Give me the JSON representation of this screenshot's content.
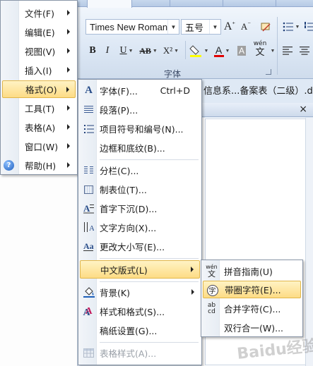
{
  "ribbon": {
    "font_name": "Times New Roman",
    "font_size": "五号",
    "group_label": "字体",
    "bold": "B",
    "italic": "I",
    "underline": "U",
    "strike": "AB",
    "superscript": "X²",
    "font_color": "A",
    "char_shading": "A",
    "phonetic": "wén",
    "grow_font": "A",
    "shrink_font": "A"
  },
  "document": {
    "title_fragment": "信息系...备案表（二级）.doc"
  },
  "task_pane": {
    "close": "×"
  },
  "main_menu": {
    "items": [
      {
        "label": "文件(F)"
      },
      {
        "label": "编辑(E)"
      },
      {
        "label": "视图(V)"
      },
      {
        "label": "插入(I)"
      },
      {
        "label": "格式(O)"
      },
      {
        "label": "工具(T)"
      },
      {
        "label": "表格(A)"
      },
      {
        "label": "窗口(W)"
      },
      {
        "label": "帮助(H)"
      }
    ]
  },
  "format_menu": {
    "items": [
      {
        "label": "字体(F)...",
        "shortcut": "Ctrl+D"
      },
      {
        "label": "段落(P)..."
      },
      {
        "label": "项目符号和编号(N)..."
      },
      {
        "label": "边框和底纹(B)..."
      },
      {
        "label": "分栏(C)..."
      },
      {
        "label": "制表位(T)..."
      },
      {
        "label": "首字下沉(D)..."
      },
      {
        "label": "文字方向(X)..."
      },
      {
        "label": "更改大小写(E)..."
      },
      {
        "label": "中文版式(L)"
      },
      {
        "label": "背景(K)"
      },
      {
        "label": "样式和格式(S)..."
      },
      {
        "label": "稿纸设置(G)..."
      },
      {
        "label": "表格样式(A)..."
      }
    ]
  },
  "chinese_layout_menu": {
    "items": [
      {
        "label": "拼音指南(U)"
      },
      {
        "label": "带圈字符(E)..."
      },
      {
        "label": "合并字符(C)..."
      },
      {
        "label": "双行合一(W)..."
      }
    ]
  },
  "icons": {
    "font": "A",
    "circle_char": "字",
    "phonetic_top": "wén",
    "phonetic_bottom": "文",
    "combine_top": "ab",
    "combine_bottom": "cd",
    "styles": "A",
    "help": "?"
  },
  "watermark": "Baidu经验"
}
